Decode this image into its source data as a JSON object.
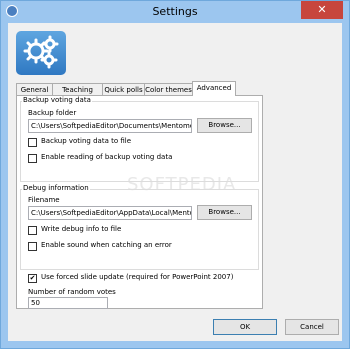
{
  "window": {
    "title": "Settings",
    "close_glyph": "✕",
    "app_icon": "mentometer-app-icon",
    "logo_icon": "gears-icon"
  },
  "tabs": [
    {
      "label": "General",
      "active": false
    },
    {
      "label": "Teaching tools",
      "active": false
    },
    {
      "label": "Quick polls",
      "active": false
    },
    {
      "label": "Color themes",
      "active": false
    },
    {
      "label": "Advanced",
      "active": true
    }
  ],
  "watermark": "SOFTPEDIA",
  "backup": {
    "group_label": "Backup voting data",
    "folder_label": "Backup folder",
    "folder_value": "C:\\Users\\SoftpediaEditor\\Documents\\Mentometer\\Backup",
    "browse_label": "Browse...",
    "checkbox1_label": "Backup voting data to file",
    "checkbox1_checked": false,
    "checkbox2_label": "Enable reading of backup voting data",
    "checkbox2_checked": false
  },
  "debug": {
    "group_label": "Debug information",
    "filename_label": "Filename",
    "filename_value": "C:\\Users\\SoftpediaEditor\\AppData\\Local\\MentometerDebug.txt",
    "browse_label": "Browse...",
    "checkbox1_label": "Write debug info to file",
    "checkbox1_checked": false,
    "checkbox2_label": "Enable sound when catching an error",
    "checkbox2_checked": false
  },
  "forced_slide": {
    "label": "Use forced slide update (required for PowerPoint 2007)",
    "checked": true,
    "check_glyph": "✔"
  },
  "random_votes": {
    "label": "Number of random votes",
    "value": "50"
  },
  "buttons": {
    "ok": "OK",
    "cancel": "Cancel"
  },
  "colors": {
    "titlebar": "#9cc6ef",
    "close": "#c7463d",
    "logo_top": "#5fa6e0",
    "logo_bottom": "#2f78c2"
  }
}
